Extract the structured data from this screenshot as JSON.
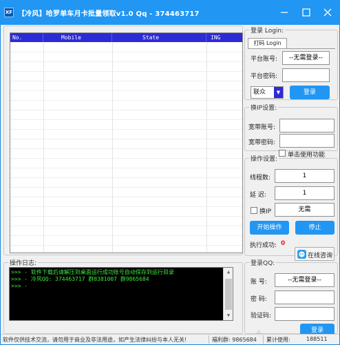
{
  "window": {
    "logo_text": "XF",
    "title": "【冷风】哈罗单车月卡批量领取v1.0    Qq - 374463717",
    "min_glyph": "—",
    "max_glyph": "☐",
    "close_glyph": "✕"
  },
  "table": {
    "columns": [
      "No.",
      "Mobile",
      "State",
      "ING"
    ]
  },
  "login": {
    "legend": "登录 Login:",
    "tab_label": "打码 Login",
    "account_label": "平台账号:",
    "account_value": "--无需登录--",
    "password_label": "平台密码:",
    "password_value": "",
    "provider_value": "联众",
    "login_button": "登录"
  },
  "ip_switch": {
    "legend": "换IP设置:",
    "broadband_account_label": "宽带账号:",
    "broadband_password_label": "宽带密码:",
    "single_use_label": "单击使用功能"
  },
  "operation": {
    "legend": "操作设置:",
    "threads_label": "线程数:",
    "threads_value": "1",
    "delay_label": "延  迟:",
    "delay_value": "1",
    "change_ip_label": "换IP",
    "change_ip_value": "无需",
    "start_button": "开始操作",
    "stop_button": "停止",
    "success_label": "执行成功:",
    "success_value": "0",
    "consult_button": "在线咨询"
  },
  "log": {
    "legend": "操作日志:",
    "lines": [
      ">>> - 软件下载后请解压到桌面运行成功账号自动保存到运行目录",
      ">>> - 冷风QQ: 374463717 群8381007 群9865684",
      ">>> - "
    ]
  },
  "qq_login": {
    "legend": "登录QQ:",
    "account_label": "账  号:",
    "account_value": "--无需登录--",
    "password_label": "密  码:",
    "captcha_label": "验证码:",
    "login_button": "登录"
  },
  "status": {
    "notice": "软件仅供技术交流，请勿用于商业及非法用途，如产生法律纠纷与本人无关!",
    "group": "福利群: 9865684",
    "usage_label": "累计使用:",
    "usage_value": "188511"
  },
  "colors": {
    "accent": "#2196f3",
    "header": "#2d2bd6",
    "console_text": "#3fe53f",
    "success_value": "#e02020"
  },
  "icons": {
    "logo": "app-logo-icon",
    "minimize": "minimize-icon",
    "maximize": "maximize-icon",
    "close": "close-icon",
    "dropdown": "chevron-down-icon",
    "consult": "chat-icon"
  }
}
